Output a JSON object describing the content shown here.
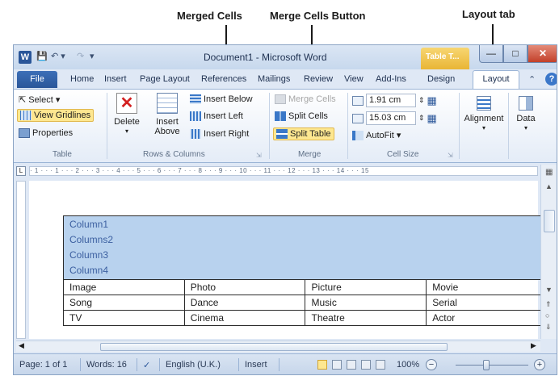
{
  "annotations": {
    "merged_cells": "Merged Cells",
    "merge_cells_button": "Merge Cells Button",
    "layout_tab": "Layout tab"
  },
  "window": {
    "title": "Document1 - Microsoft Word",
    "context_tab": "Table T...",
    "app_icon": "W"
  },
  "tabs": {
    "file": "File",
    "items": [
      "Home",
      "Insert",
      "Page Layout",
      "References",
      "Mailings",
      "Review",
      "View",
      "Add-Ins",
      "Design"
    ],
    "active": "Layout"
  },
  "ribbon": {
    "table": {
      "select": "Select ▾",
      "view_gridlines": "View Gridlines",
      "properties": "Properties",
      "label": "Table"
    },
    "rows_columns": {
      "delete": "Delete",
      "insert_above_1": "Insert",
      "insert_above_2": "Above",
      "insert_below": "Insert Below",
      "insert_left": "Insert Left",
      "insert_right": "Insert Right",
      "label": "Rows & Columns"
    },
    "merge": {
      "merge_cells": "Merge Cells",
      "split_cells": "Split Cells",
      "split_table": "Split Table",
      "label": "Merge"
    },
    "cell_size": {
      "height": "1.91 cm",
      "width": "15.03 cm",
      "autofit": "AutoFit ▾",
      "label": "Cell Size"
    },
    "alignment": {
      "label": "Alignment"
    },
    "data": {
      "label": "Data"
    }
  },
  "ruler": {
    "text": "· 1 · · · 1 · · · 2 · · · 3 · · · 4 · · · 5 · · · 6 · · · 7 · · · 8 · · · 9 · · · 10 · · · 11 · · · 12 · · · 13 · · · 14 · · · 15"
  },
  "table": {
    "merged_lines": [
      "Column1",
      "Columns2",
      "Column3",
      "Column4"
    ],
    "rows": [
      [
        "Image",
        "Photo",
        "Picture",
        "Movie"
      ],
      [
        "Song",
        "Dance",
        "Music",
        "Serial"
      ],
      [
        "TV",
        "Cinema",
        "Theatre",
        "Actor"
      ]
    ]
  },
  "status": {
    "page": "Page: 1 of 1",
    "words": "Words: 16",
    "language": "English (U.K.)",
    "mode": "Insert",
    "zoom": "100%",
    "zoom_out": "−",
    "zoom_in": "+"
  },
  "colors": {
    "merged_fill": "#b8d2ee",
    "ribbon_highlight": "#fde790"
  },
  "icons": {
    "merge_cells": "merge-cells-icon",
    "split_cells": "split-cells-icon",
    "split_table": "split-table-icon",
    "delete": "delete-table-icon"
  }
}
